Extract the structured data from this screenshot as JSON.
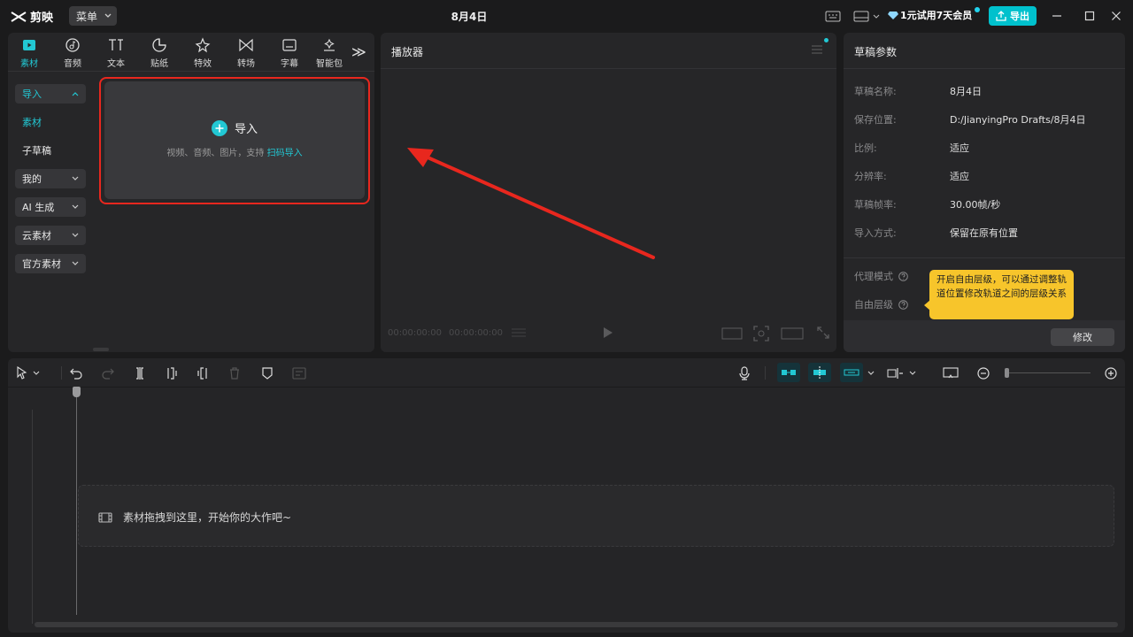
{
  "app": {
    "name": "剪映",
    "menu_label": "菜单",
    "project_title": "8月4日",
    "trial_label": "1元试用7天会员",
    "export_label": "导出",
    "accent": "#00c1cd",
    "annotation_red": "#e8271e"
  },
  "media_tabs": [
    {
      "label": "素材",
      "icon": "media-icon",
      "active": true
    },
    {
      "label": "音频",
      "icon": "audio-icon"
    },
    {
      "label": "文本",
      "icon": "text-icon"
    },
    {
      "label": "贴纸",
      "icon": "sticker-icon"
    },
    {
      "label": "特效",
      "icon": "effects-icon"
    },
    {
      "label": "转场",
      "icon": "transition-icon"
    },
    {
      "label": "字幕",
      "icon": "subtitle-icon"
    },
    {
      "label": "智能包",
      "icon": "smart-icon"
    }
  ],
  "sidebar": {
    "items": [
      {
        "label": "导入"
      },
      {
        "label": "素材"
      },
      {
        "label": "子草稿"
      },
      {
        "label": "我的"
      },
      {
        "label": "AI 生成"
      },
      {
        "label": "云素材"
      },
      {
        "label": "官方素材"
      }
    ]
  },
  "import_area": {
    "title": "导入",
    "subtitle": "视频、音频、图片，支持",
    "link": "扫码导入"
  },
  "player": {
    "title": "播放器",
    "current_time": "00:00:00:00",
    "total_time": "00:00:00:00"
  },
  "draft": {
    "title": "草稿参数",
    "rows": [
      {
        "label": "草稿名称:",
        "value": "8月4日"
      },
      {
        "label": "保存位置:",
        "value": "D:/JianyingPro Drafts/8月4日"
      },
      {
        "label": "比例:",
        "value": "适应"
      },
      {
        "label": "分辨率:",
        "value": "适应"
      },
      {
        "label": "草稿帧率:",
        "value": "30.00帧/秒"
      },
      {
        "label": "导入方式:",
        "value": "保留在原有位置"
      }
    ],
    "proxy_label": "代理模式",
    "free_layer_label": "自由层级",
    "tooltip": "开启自由层级，可以通过调整轨道位置修改轨道之间的层级关系",
    "modify_label": "修改"
  },
  "timeline": {
    "drop_hint": "素材拖拽到这里，开始你的大作吧~"
  }
}
